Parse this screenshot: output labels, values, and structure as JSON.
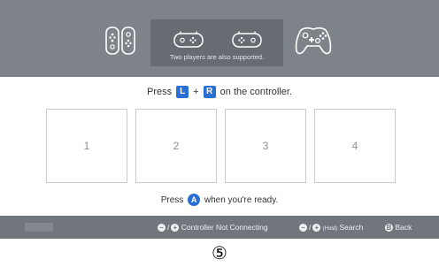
{
  "header": {
    "popup_text": "Two players are also supported."
  },
  "instruction": {
    "prefix": "Press",
    "key_left": "L",
    "plus": "+",
    "key_right": "R",
    "suffix": "on the controller."
  },
  "slots": [
    "1",
    "2",
    "3",
    "4"
  ],
  "ready": {
    "prefix": "Press",
    "button": "A",
    "suffix": "when you're ready."
  },
  "footer": {
    "minus_symbol": "−",
    "plus_symbol": "+",
    "slash": "/",
    "not_connecting_label": "Controller Not Connecting",
    "hold_label": "(Hold)",
    "search_label": "Search",
    "back_button": "B",
    "back_label": "Back"
  },
  "caption": "⑤"
}
